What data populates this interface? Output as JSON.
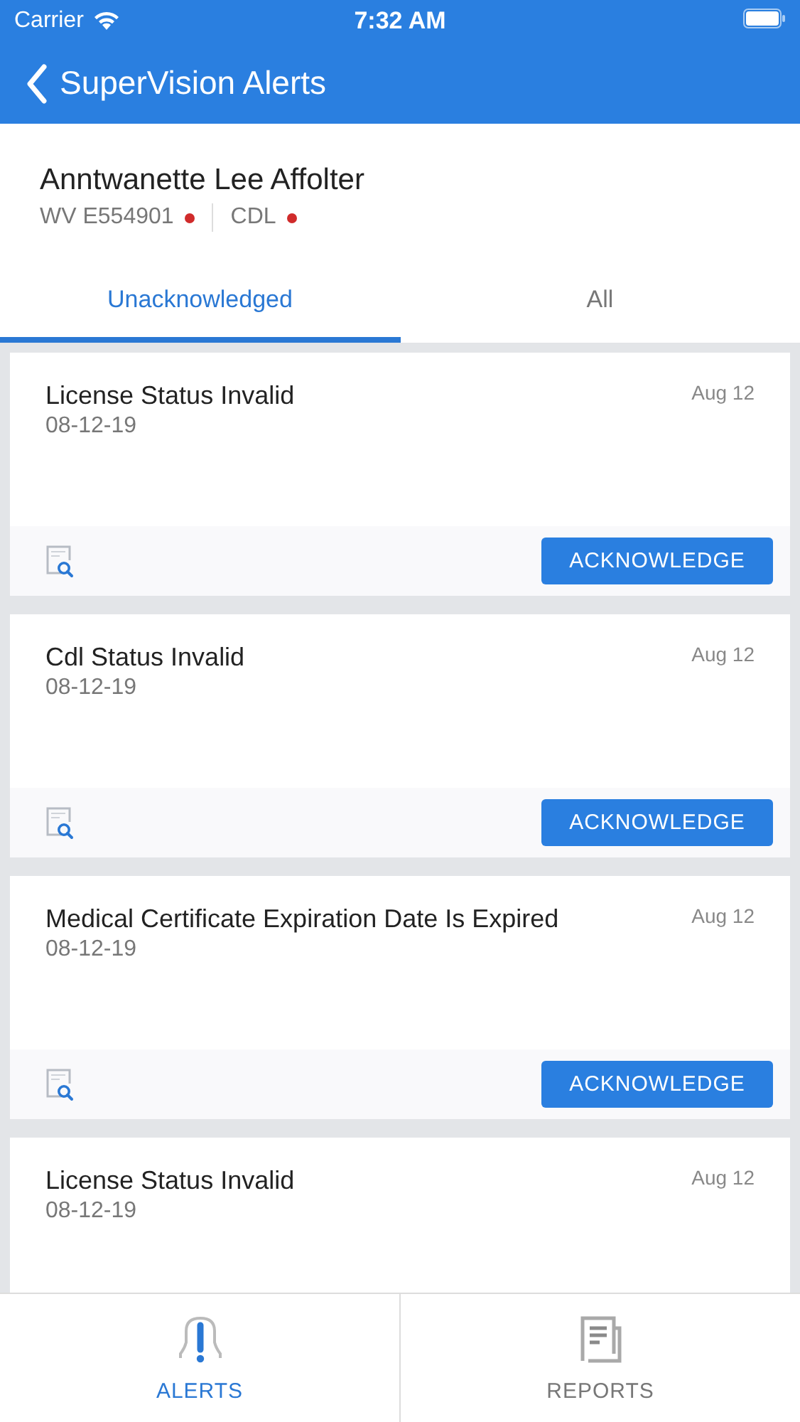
{
  "status_bar": {
    "carrier": "Carrier",
    "time": "7:32 AM"
  },
  "nav": {
    "title": "SuperVision Alerts"
  },
  "driver": {
    "name": "Anntwanette Lee Affolter",
    "credentials": [
      {
        "label": "WV E554901",
        "alert": true
      },
      {
        "label": "CDL",
        "alert": true
      }
    ]
  },
  "tabs": [
    {
      "label": "Unacknowledged",
      "selected": true
    },
    {
      "label": "All",
      "selected": false
    }
  ],
  "alerts": [
    {
      "title": "License Status Invalid",
      "date": "08-12-19",
      "received": "Aug 12",
      "action": "ACKNOWLEDGE"
    },
    {
      "title": "Cdl Status Invalid",
      "date": "08-12-19",
      "received": "Aug 12",
      "action": "ACKNOWLEDGE"
    },
    {
      "title": "Medical Certificate Expiration Date Is Expired",
      "date": "08-12-19",
      "received": "Aug 12",
      "action": "ACKNOWLEDGE"
    },
    {
      "title": "License Status Invalid",
      "date": "08-12-19",
      "received": "Aug 12"
    }
  ],
  "bottom_tabs": [
    {
      "label": "ALERTS",
      "kind": "alerts",
      "selected": true
    },
    {
      "label": "REPORTS",
      "kind": "reports",
      "selected": false
    }
  ]
}
